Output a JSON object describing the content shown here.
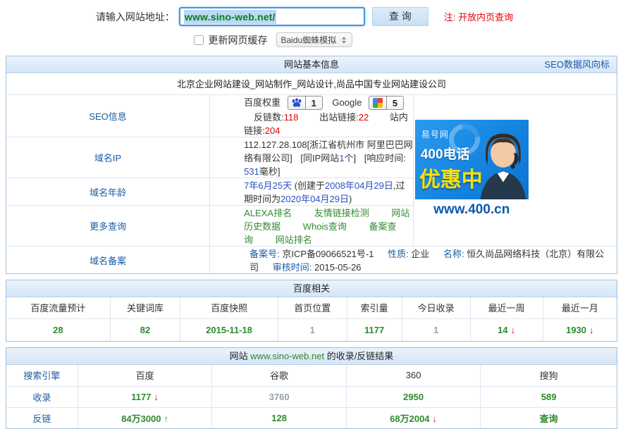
{
  "query_bar": {
    "label": "请输入网站地址：",
    "input_value": "www.sino-web.net/",
    "search_button": "查 询",
    "note": "注: 开放内页查询",
    "cache_checkbox_label": "更新网页缓存",
    "spider_select_value": "Baidu蜘蛛模拟"
  },
  "trend_icons": {
    "up": "↑",
    "down": "↓"
  },
  "basic_info": {
    "header_title": "网站基本信息",
    "header_link": "SEO数据风向标",
    "site_title": "北京企业网站建设_网站制作_网站设计,尚品中国专业网站建设公司",
    "seo": {
      "row_label": "SEO信息",
      "baidu_weight_label": "百度权重",
      "baidu_weight_value": "1",
      "google_label": "Google",
      "google_pr_value": "5",
      "stats": [
        {
          "label": "反链数:",
          "value": "118"
        },
        {
          "label": "出站链接:",
          "value": "22"
        },
        {
          "label": "站内链接:",
          "value": "204"
        }
      ]
    },
    "ip": {
      "row_label": "域名IP",
      "address": "112.127.28.108",
      "location": "[浙江省杭州市 阿里巴巴网络有限公司]",
      "same_ip_prefix": "[同IP网站",
      "same_ip_count": "1",
      "same_ip_suffix": "个]",
      "response_label": "[响应时间: ",
      "response_value": "531",
      "response_suffix": "毫秒]"
    },
    "age": {
      "row_label": "域名年龄",
      "age_text": "7年6月25天",
      "created_prefix": " (创建于",
      "created_date": "2008年04月29日",
      "between_text": ",过期时间为",
      "expire_date": "2020年04月29日",
      "suffix": ")"
    },
    "more": {
      "row_label": "更多查询",
      "links": [
        "ALEXA排名",
        "友情链接检测",
        "网站历史数据",
        "Whois查询",
        "备案查询",
        "网站排名"
      ]
    },
    "beian": {
      "row_label": "域名备案",
      "fields": [
        {
          "label": "备案号: ",
          "value": "京ICP备09066521号-1"
        },
        {
          "label": "性质: ",
          "value": "企业"
        },
        {
          "label": "名称: ",
          "value": "恒久尚品网络科技（北京）有限公司"
        },
        {
          "label": "审核时间: ",
          "value": "2015-05-26"
        }
      ]
    }
  },
  "ad": {
    "brand": "易号网",
    "line1": "400电话",
    "line2": "优惠中",
    "url": "www.400.cn"
  },
  "baidu_panel": {
    "title": "百度相关",
    "columns": [
      "百度流量预计",
      "关键词库",
      "百度快照",
      "首页位置",
      "索引量",
      "今日收录",
      "最近一周",
      "最近一月"
    ],
    "values": [
      {
        "text": "28"
      },
      {
        "text": "82"
      },
      {
        "text": "2015-11-18"
      },
      {
        "text": "1",
        "muted": true
      },
      {
        "text": "1177"
      },
      {
        "text": "1",
        "muted": true
      },
      {
        "text": "14",
        "trend": "down"
      },
      {
        "text": "1930",
        "trend": "down"
      }
    ]
  },
  "result_panel": {
    "title_prefix": "网站 ",
    "domain": "www.sino-web.net",
    "title_suffix": " 的收录/反链结果",
    "header_label": "搜索引擎",
    "engines": [
      "百度",
      "谷歌",
      "360",
      "搜狗"
    ],
    "rows": [
      {
        "label": "收录",
        "cells": [
          {
            "text": "1177",
            "trend": "down"
          },
          {
            "text": "3760",
            "muted": true
          },
          {
            "text": "2950"
          },
          {
            "text": "589"
          }
        ]
      },
      {
        "label": "反链",
        "cells": [
          {
            "text": "84万3000",
            "trend": "up"
          },
          {
            "text": "128"
          },
          {
            "text": "68万2004",
            "trend": "down"
          },
          {
            "text": "查询",
            "link": true
          }
        ]
      }
    ]
  }
}
